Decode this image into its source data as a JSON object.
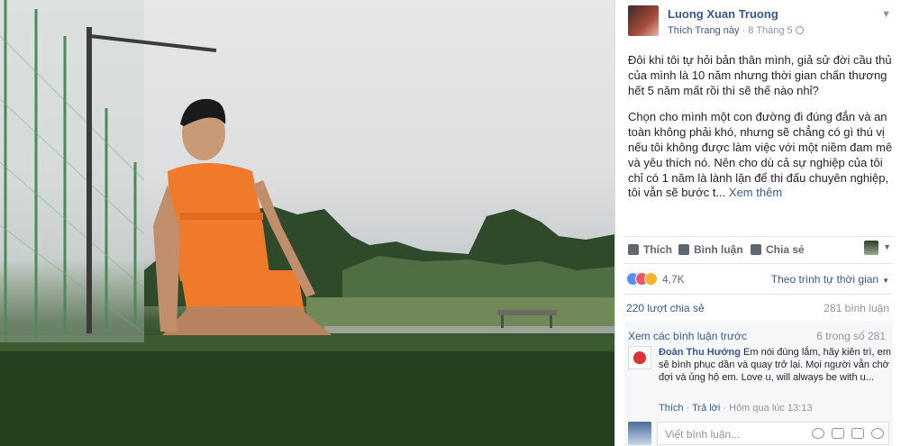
{
  "post": {
    "author": "Luong Xuan Truong",
    "like_page": "Thích Trang này",
    "separator": " · ",
    "date": "8 Tháng 5",
    "paragraphs": [
      "Đôi khi tôi tự hỏi bản thân mình, giả sử đời cầu thủ của mình là 10 năm nhưng thời gian chấn thương hết 5 năm mất rồi thì sẽ thế nào nhỉ?",
      "Chọn cho mình một con đường đi đúng đắn và an toàn không phải khó, nhưng sẽ chẳng có gì thú vị nếu tôi không được làm việc với một niềm đam mê và yêu thích nó. Nên cho dù cả sự nghiệp của tôi chỉ có 1 năm là lành lặn để thi đấu chuyên nghiệp, tôi vẫn sẽ bước t..."
    ],
    "see_more": "Xem thêm"
  },
  "actions": {
    "like": "Thích",
    "comment": "Bình luận",
    "share": "Chia sẻ"
  },
  "reactions": {
    "count": "4,7K",
    "sort": "Theo trình tự thời gian"
  },
  "stats": {
    "shares": "220 lượt chia sẻ",
    "comments": "281 bình luận"
  },
  "comments": {
    "view_previous": "Xem các bình luận trước",
    "position": "6 trong số 281",
    "items": [
      {
        "name": "Đoàn Thu Hướng",
        "text": "Em nói đúng lắm, hãy kiên trì, em sẽ bình phục dần và quay trở lại. Mọi người vẫn chờ đợi và ủng hộ em. Love u, will always be with u...",
        "like": "Thích",
        "reply": "Trả lời",
        "time": "Hôm qua lúc 13:13"
      }
    ],
    "write_placeholder": "Viết bình luận..."
  },
  "icons": {
    "post_menu": "chevron-down-icon",
    "like": "thumbs-up-icon",
    "comment": "speech-bubble-icon",
    "share": "share-arrow-icon",
    "camera": "camera-icon",
    "emoji": "emoji-icon",
    "sticker": "sticker-icon",
    "gif": "gif-icon"
  },
  "colors": {
    "link": "#365899",
    "muted": "#90949c",
    "jersey": "#f07a2a"
  }
}
